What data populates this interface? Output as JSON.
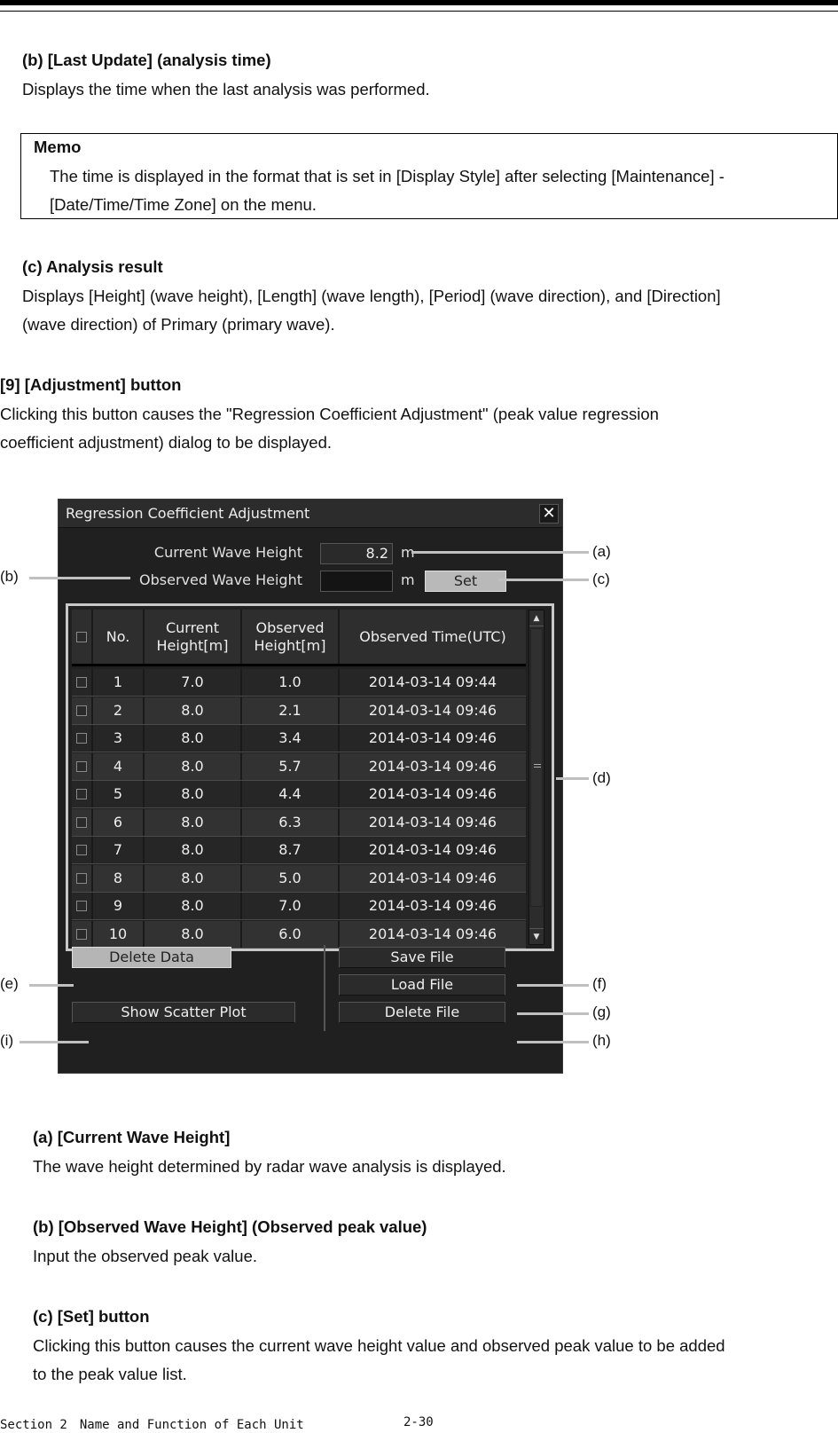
{
  "doc": {
    "section_b_last_update": {
      "heading": "(b) [Last Update] (analysis time)",
      "body": "Displays the time when the last analysis was performed."
    },
    "memo": {
      "title": "Memo",
      "line1": "The time is displayed in the format that is set in [Display Style] after selecting [Maintenance] -",
      "line2": "[Date/Time/Time Zone] on the menu."
    },
    "section_c_analysis": {
      "heading": "(c) Analysis result",
      "line1": "Displays [Height] (wave height), [Length] (wave length), [Period] (wave direction), and [Direction]",
      "line2": "(wave direction) of Primary (primary wave)."
    },
    "section_9": {
      "heading": "[9] [Adjustment] button",
      "line1": "Clicking this button causes the \"Regression Coefficient Adjustment\" (peak value regression",
      "line2": "coefficient adjustment) dialog to be displayed."
    },
    "desc_a": {
      "heading": "(a) [Current Wave Height]",
      "body": "The wave height determined by radar wave analysis is displayed."
    },
    "desc_b": {
      "heading": "(b) [Observed Wave Height] (Observed peak value)",
      "body": "Input the observed peak value."
    },
    "desc_c": {
      "heading": "(c) [Set] button",
      "line1": "Clicking this button causes the current wave height value and observed peak value to be added",
      "line2": "to the peak value list."
    },
    "footer": {
      "section": "Section 2　Name and Function of Each Unit",
      "page": "2-30"
    }
  },
  "dialog": {
    "title": "Regression Coefficient Adjustment",
    "close_icon": "close-icon",
    "current_wave_height_label": "Current Wave Height",
    "current_wave_height_value": "8.2",
    "observed_wave_height_label": "Observed Wave Height",
    "observed_wave_height_value": "",
    "unit": "m",
    "set_label": "Set",
    "table": {
      "headers": [
        "No.",
        "Current\nHeight[m]",
        "Observed\nHeight[m]",
        "Observed Time(UTC)"
      ],
      "rows": [
        {
          "no": "1",
          "current": "7.0",
          "observed": "1.0",
          "time": "2014-03-14 09:44"
        },
        {
          "no": "2",
          "current": "8.0",
          "observed": "2.1",
          "time": "2014-03-14 09:46"
        },
        {
          "no": "3",
          "current": "8.0",
          "observed": "3.4",
          "time": "2014-03-14 09:46"
        },
        {
          "no": "4",
          "current": "8.0",
          "observed": "5.7",
          "time": "2014-03-14 09:46"
        },
        {
          "no": "5",
          "current": "8.0",
          "observed": "4.4",
          "time": "2014-03-14 09:46"
        },
        {
          "no": "6",
          "current": "8.0",
          "observed": "6.3",
          "time": "2014-03-14 09:46"
        },
        {
          "no": "7",
          "current": "8.0",
          "observed": "8.7",
          "time": "2014-03-14 09:46"
        },
        {
          "no": "8",
          "current": "8.0",
          "observed": "5.0",
          "time": "2014-03-14 09:46"
        },
        {
          "no": "9",
          "current": "8.0",
          "observed": "7.0",
          "time": "2014-03-14 09:46"
        },
        {
          "no": "10",
          "current": "8.0",
          "observed": "6.0",
          "time": "2014-03-14 09:46"
        }
      ]
    },
    "buttons": {
      "delete_data": "Delete Data",
      "show_scatter_plot": "Show Scatter Plot",
      "save_file": "Save File",
      "load_file": "Load File",
      "delete_file": "Delete File"
    }
  },
  "callouts": {
    "a": "(a)",
    "b": "(b)",
    "c": "(c)",
    "d": "(d)",
    "e": "(e)",
    "f": "(f)",
    "g": "(g)",
    "h": "(h)",
    "i": "(i)"
  }
}
